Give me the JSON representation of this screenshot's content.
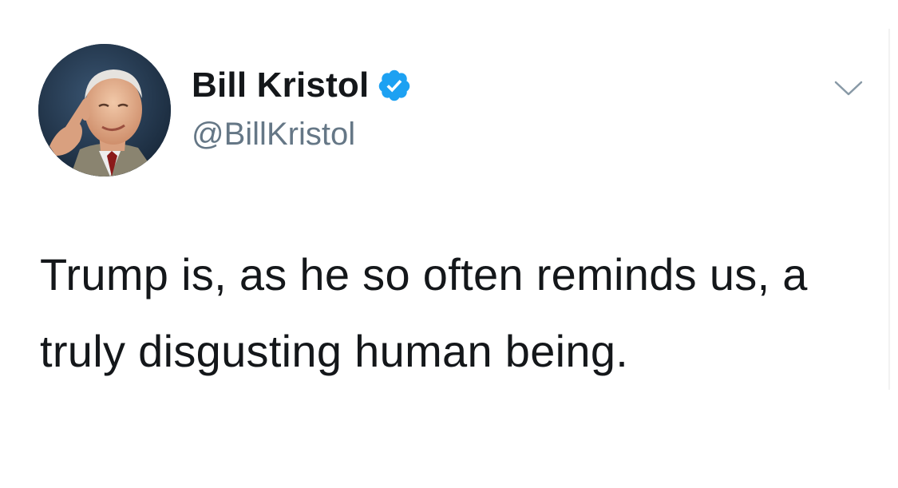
{
  "author": {
    "display_name": "Bill Kristol",
    "handle": "@BillKristol",
    "verified": true
  },
  "tweet": {
    "text": "Trump is, as he so often reminds us, a truly disgusting human being."
  },
  "icons": {
    "verified": "verified-badge-icon",
    "menu": "chevron-down-icon"
  },
  "colors": {
    "verified_blue": "#1da1f2",
    "text": "#14171a",
    "secondary_text": "#657786"
  }
}
